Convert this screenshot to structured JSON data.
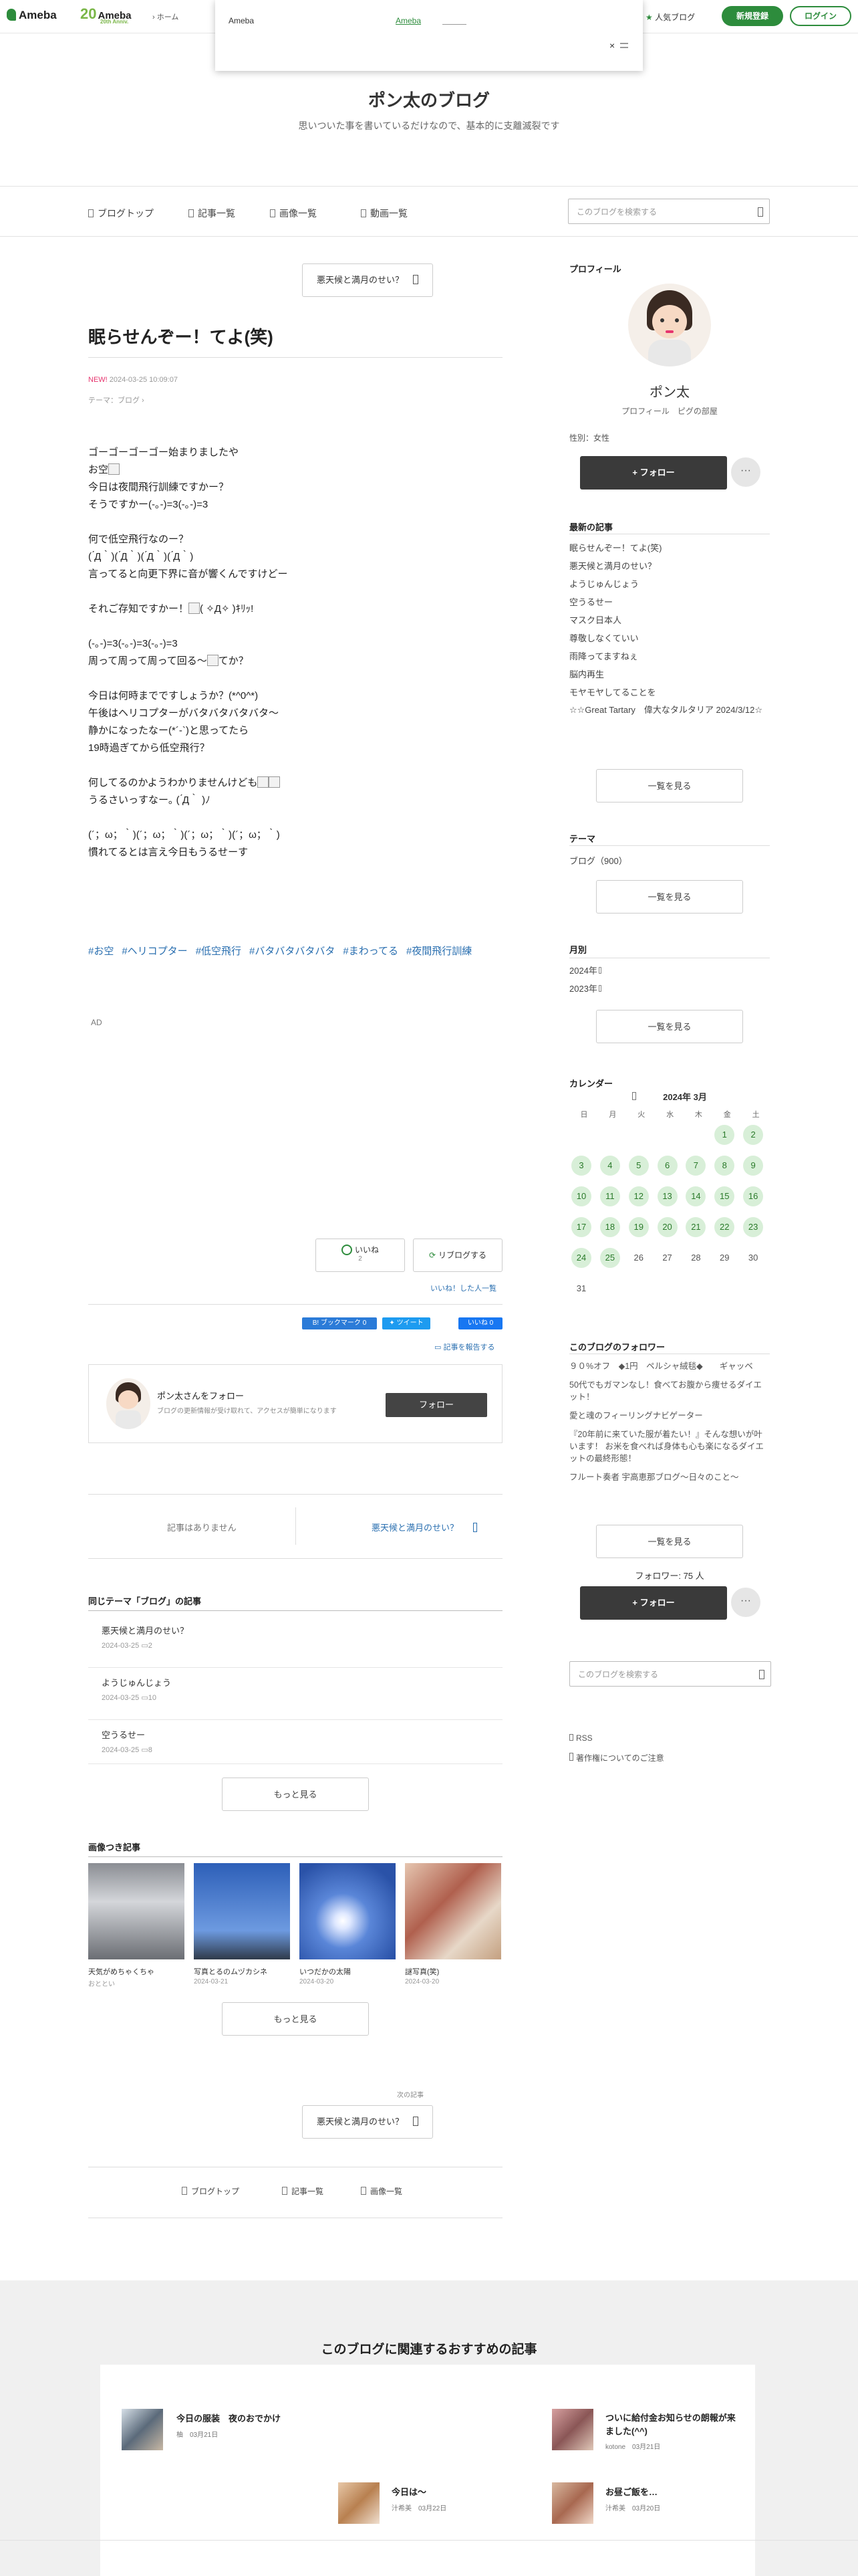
{
  "topbar": {
    "logo_text": "Ameba",
    "logo2_text": "Ameba",
    "logo2_sub": "20th Anniv.",
    "home_label": "ホーム",
    "popular_label": "人気ブログ",
    "signup_label": "新規登録",
    "login_label": "ログイン"
  },
  "popup": {
    "brand": "Ameba",
    "link": "Ameba",
    "close": "×"
  },
  "header": {
    "blog_title": "ポン太のブログ",
    "blog_desc": "思いついた事を書いているだけなので、基本的に支離滅裂です"
  },
  "nav": {
    "items": [
      "ブログトップ",
      "記事一覧",
      "画像一覧",
      "動画一覧"
    ],
    "search_placeholder": "このブログを検索する"
  },
  "article": {
    "prev_label": "悪天候と満月のせい？",
    "title": "眠らせんぞー！てよ(笑)",
    "new_badge": "NEW!",
    "date": "2024-03-25 10:09:07",
    "theme": "テーマ：ブログ",
    "body": [
      "ゴーゴーゴーゴー始まりましたや",
      "お空",
      "今日は夜間飛行訓練ですかー？",
      "そうですかー(-｡-)=3(-｡-)=3",
      "",
      "何で低空飛行なのー？",
      "( ́Д｀)( ́Д｀)( ́Д｀)( ́Д｀)",
      "言ってると向更下界に音が響くんですけどー",
      "",
      "それご存知ですかー！",
      "",
      "(-｡-)=3(-｡-)=3(-｡-)=3",
      "周って周って周って回る〜",
      "",
      "今日は何時までですしょうか？(*^0^*)",
      "午後はヘリコプターがバタバタバタバタ〜",
      "静かになったなー(*´-`)と思ってたら",
      "19時過ぎてから低空飛行？",
      "",
      "何してるのかようわかりませんけども",
      "うるさいっすなー｡ ( ́Д｀ )ﾉ",
      "",
      "(´；ω；｀)(´；ω；｀)(´；ω；｀)(´；ω；｀)",
      "慣れてるとは言え今日もうるせーす"
    ],
    "hashtags": [
      "#お空",
      "#ヘリコプター",
      "#低空飛行",
      "#バタバタバタバタ",
      "#まわってる",
      "#夜間飛行訓練"
    ],
    "ad_label": "AD",
    "like_label": "いいね",
    "like_count": "2",
    "reblog_label": "リブログする",
    "like_users": "いいね！した人一覧",
    "hatena_label": "B! ブックマーク",
    "hatena_count": "0",
    "tweet_label": "ツイート",
    "fb_label": "いいね 0",
    "report_label": "記事を報告する",
    "follow_card_title": "ポン太さんをフォロー",
    "follow_card_desc": "ブログの更新情報が受け取れて、アクセスが簡単になります",
    "follow_card_btn": "フォロー",
    "no_article": "記事はありません",
    "next_article": "悪天候と満月のせい？",
    "same_theme_title": "同じテーマ「ブログ」の記事",
    "same_theme": [
      {
        "title": "悪天候と満月のせい？",
        "date": "2024-03-25",
        "comments": "2"
      },
      {
        "title": "ようじゅんじょう",
        "date": "2024-03-25",
        "comments": "10"
      },
      {
        "title": "空うるせー",
        "date": "2024-03-25",
        "comments": "8"
      }
    ],
    "more_label": "もっと見る",
    "image_articles_title": "画像つき記事",
    "image_articles": [
      {
        "title": "天気がめちゃくちゃ",
        "date": "おととい"
      },
      {
        "title": "写真とるのムヅカシネ",
        "date": "2024-03-21"
      },
      {
        "title": "いつだかの太陽",
        "date": "2024-03-20"
      },
      {
        "title": "謎写真(笑)",
        "date": "2024-03-20"
      }
    ],
    "more_label2": "もっと見る",
    "next_label": "次の記事",
    "next_btn": "悪天候と満月のせい？",
    "bottom_nav": [
      "ブログトップ",
      "記事一覧",
      "画像一覧"
    ]
  },
  "sidebar": {
    "profile_title": "プロフィール",
    "name": "ポン太",
    "profile_link": "プロフィール",
    "room_link": "ピグの部屋",
    "gender": "性別：女性",
    "follow_label": "+ フォロー",
    "recent_title": "最新の記事",
    "recent": [
      "眠らせんぞー！てよ(笑)",
      "悪天候と満月のせい？",
      "ようじゅんじょう",
      "空うるせー",
      "マスク日本人",
      "尊敬しなくていい",
      "雨降ってますねぇ",
      "脳内再生",
      "モヤモヤしてることを",
      "☆☆Great Tartary　偉大なタルタリア 2024/3/12☆"
    ],
    "list_more": "一覧を見る",
    "theme_title": "テーマ",
    "theme_item": "ブログ（900）",
    "theme_more": "一覧を見る",
    "month_title": "月別",
    "months": [
      "2024年",
      "2023年"
    ],
    "month_more": "一覧を見る",
    "calendar_title": "カレンダー",
    "calendar_month": "2024年 3月",
    "weekdays": [
      "日",
      "月",
      "火",
      "水",
      "木",
      "金",
      "土"
    ],
    "followers_title": "このブログのフォロワー",
    "followers": [
      "９０%オフ　◆1円　ペルシャ絨毯◆　　ギャッベ",
      "50代でもガマンなし！食べてお腹から痩せるダイエット！",
      "愛と魂のフィーリングナビゲーター",
      "『20年前に来ていた服が着たい！』そんな想いが叶います！ お米を食べれば身体も心も楽になるダイエットの最終形態！",
      "フルート奏者 宇高恵那ブログ〜日々のこと〜"
    ],
    "followers_more": "一覧を見る",
    "follower_count": "フォロワー: 75 人",
    "follow_label2": "+ フォロー",
    "search_placeholder": "このブログを検索する",
    "rss": "RSS",
    "copyright": "著作権についてのご注意"
  },
  "footer": {
    "title": "このブログに関連するおすすめの記事",
    "recs": [
      {
        "title": "今日の服装　夜のおでかけ",
        "meta": "柚　03月21日"
      },
      {
        "title": "ついに給付金お知らせの朗報が来ました(^^)",
        "meta": "kotone　03月21日"
      },
      {
        "title": "今日は〜",
        "meta": "汁希美　03月22日"
      },
      {
        "title": "お昼ご飯を…",
        "meta": "汁希美　03月20日"
      }
    ]
  }
}
